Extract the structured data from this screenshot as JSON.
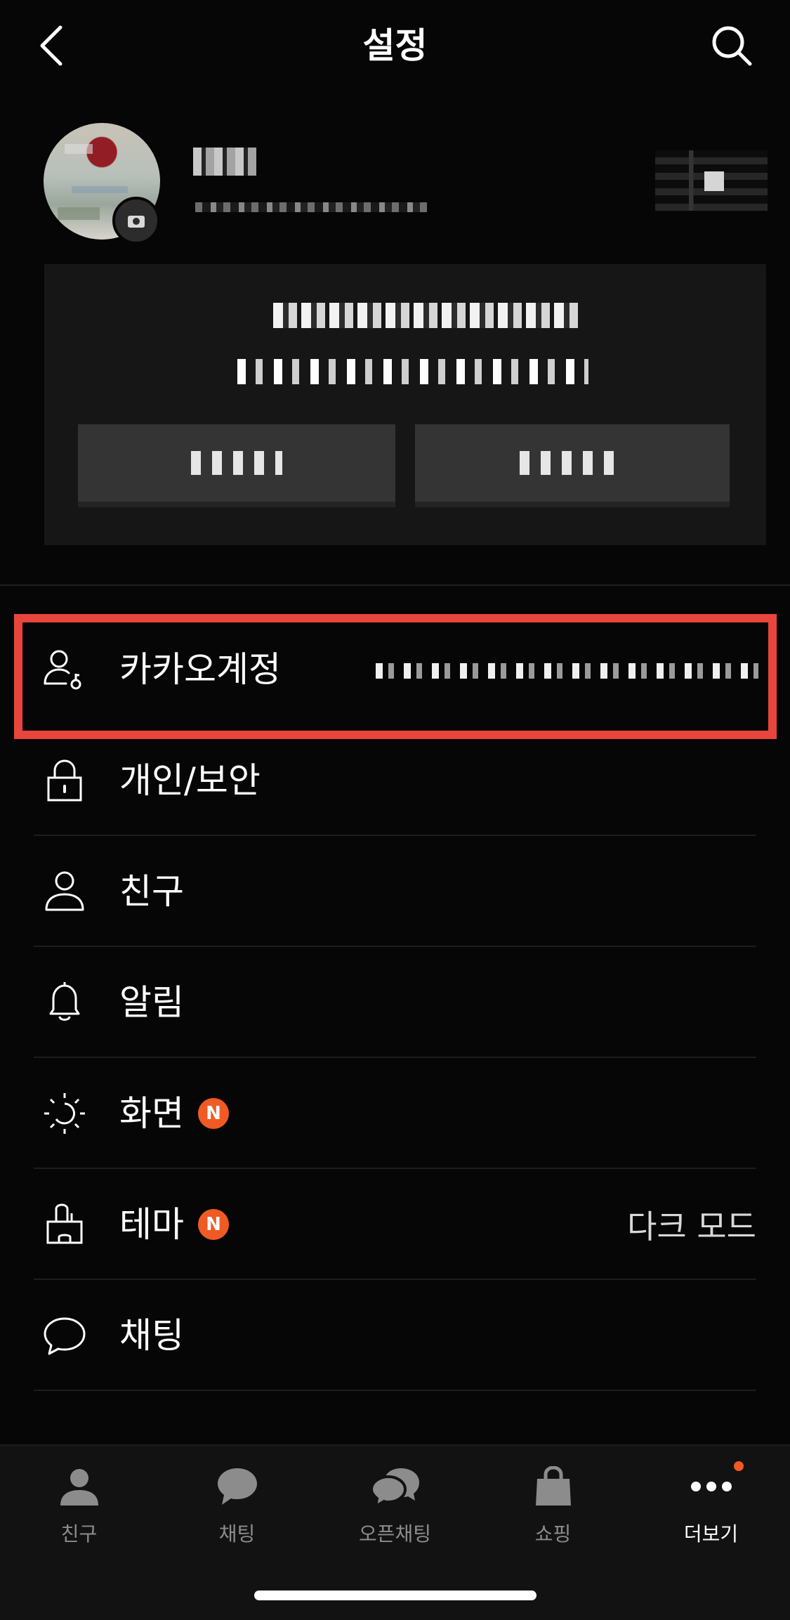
{
  "header": {
    "title": "설정"
  },
  "settings": {
    "items": [
      {
        "label": "카카오계정",
        "icon": "account-icon"
      },
      {
        "label": "개인/보안",
        "icon": "lock-icon"
      },
      {
        "label": "친구",
        "icon": "person-icon"
      },
      {
        "label": "알림",
        "icon": "bell-icon"
      },
      {
        "label": "화면",
        "icon": "display-icon",
        "badge": "N"
      },
      {
        "label": "테마",
        "icon": "theme-brush-icon",
        "badge": "N",
        "value": "다크 모드"
      },
      {
        "label": "채팅",
        "icon": "chat-bubble-icon"
      }
    ]
  },
  "tabbar": {
    "tabs": [
      {
        "label": "친구",
        "icon": "friends-icon"
      },
      {
        "label": "채팅",
        "icon": "chat-icon"
      },
      {
        "label": "오픈채팅",
        "icon": "open-chat-icon"
      },
      {
        "label": "쇼핑",
        "icon": "shopping-bag-icon"
      },
      {
        "label": "더보기",
        "icon": "more-icon",
        "active": true
      }
    ]
  },
  "colors": {
    "background": "#060606",
    "highlight": "#e8453c",
    "badge": "#f05a24",
    "tabbar": "#121212"
  }
}
